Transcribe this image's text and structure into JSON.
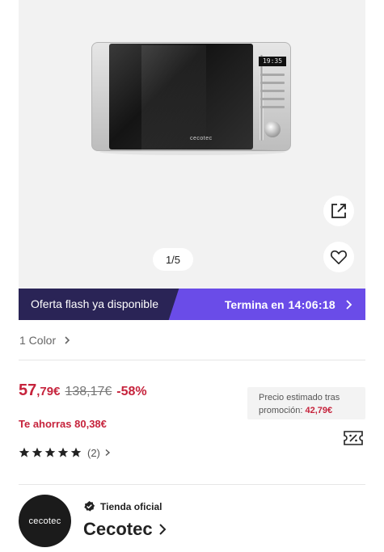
{
  "product": {
    "image_alt": "Cecotec microwave",
    "brand_on_product": "cecotec",
    "display_time": "19:35",
    "gallery_counter": "1/5"
  },
  "flash": {
    "label": "Oferta flash ya disponible",
    "ends_label": "Termina en",
    "timer": "14:06:18"
  },
  "variant": {
    "color_label": "1 Color"
  },
  "pricing": {
    "current_whole": "57",
    "current_rest": ",79€",
    "original": "138,17€",
    "discount": "-58%",
    "savings": "Te ahorras 80,38€",
    "promo_line1": "Precio estimado tras",
    "promo_line2": "promoción:",
    "promo_value": "42,79€"
  },
  "rating": {
    "stars": 5,
    "count": "(2)"
  },
  "store": {
    "logo_text": "cecotec",
    "official_label": "Tienda oficial",
    "name": "Cecotec"
  },
  "colors": {
    "price_red": "#c6233c",
    "flash_dark": "#2a2456",
    "flash_purple": "#6a4ce8"
  },
  "icons": [
    "share-icon",
    "heart-icon",
    "chevron-right-icon",
    "star-icon",
    "coupon-icon",
    "verified-badge-icon"
  ]
}
